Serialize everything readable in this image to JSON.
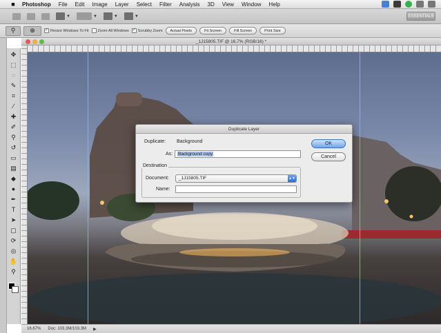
{
  "menubar": {
    "apple_icon": "apple-logo",
    "items": [
      "Photoshop",
      "File",
      "Edit",
      "Image",
      "Layer",
      "Select",
      "Filter",
      "Analysis",
      "3D",
      "View",
      "Window",
      "Help"
    ]
  },
  "appbar": {
    "icons": [
      "ps-launch-icon",
      "bridge-icon",
      "mini-bridge-icon",
      "extras-dropdown-icon",
      "zoom-level-dropdown",
      "arrange-documents-icon",
      "screen-mode-icon"
    ],
    "workspace_button": "ESSENTIALS"
  },
  "options_bar": {
    "checkbox_resize": "Resize Windows To Fit",
    "checkbox_zoom_all": "Zoom All Windows",
    "checkbox_scrubby": "Scrubby Zoom",
    "button_actual": "Actual Pixels",
    "button_fit": "Fit Screen",
    "button_fill": "Fill Screen",
    "button_print": "Print Size"
  },
  "document": {
    "title": "_1J15805.TIF @ 16.7% (RGB/16) *"
  },
  "status_bar": {
    "zoom": "16.67%",
    "doc_info": "Doc: 103.3M/103.3M"
  },
  "dialog": {
    "title": "Duplicate Layer",
    "duplicate_label": "Duplicate:",
    "duplicate_value": "Background",
    "as_label": "As:",
    "as_value": "Background copy",
    "destination_legend": "Destination",
    "document_label": "Document:",
    "document_value": "_1J15805.TIF",
    "name_label": "Name:",
    "name_value": "",
    "ok_label": "OK",
    "cancel_label": "Cancel"
  },
  "colors": {
    "guide": "#35e0ef",
    "ok_button": "#6ea6ee"
  }
}
